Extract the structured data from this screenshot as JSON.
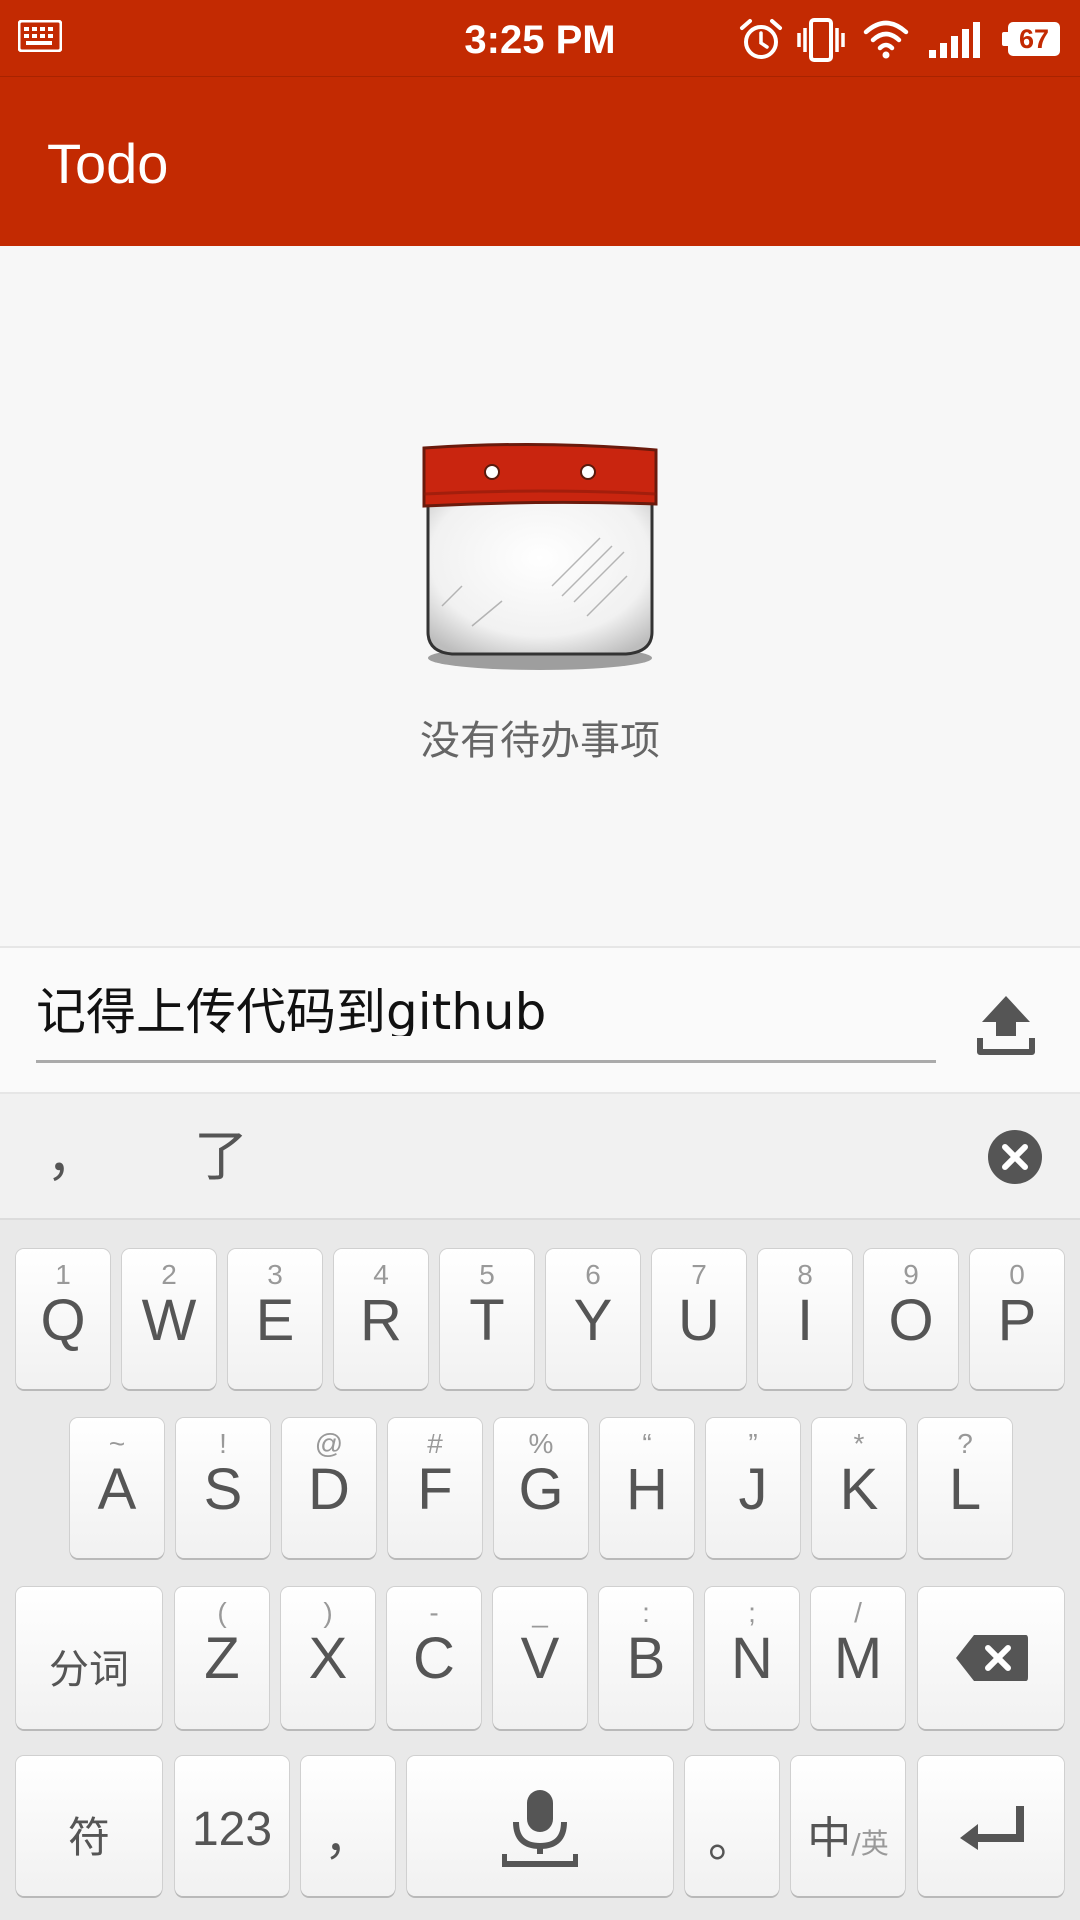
{
  "status_bar": {
    "time": "3:25 PM",
    "battery_level": "67",
    "icons": [
      "keyboard-icon",
      "alarm-icon",
      "vibrate-icon",
      "wifi-icon",
      "signal-icon",
      "battery-icon"
    ]
  },
  "app_bar": {
    "title": "Todo"
  },
  "empty_state": {
    "icon": "calendar-icon",
    "text": "没有待办事项"
  },
  "input": {
    "value": "记得上传代码到github",
    "submit_icon": "upload-icon"
  },
  "candidates": {
    "items": [
      "，",
      "了"
    ],
    "close_icon": "close-icon"
  },
  "keyboard": {
    "row1": [
      {
        "main": "Q",
        "sub": "1"
      },
      {
        "main": "W",
        "sub": "2"
      },
      {
        "main": "E",
        "sub": "3"
      },
      {
        "main": "R",
        "sub": "4"
      },
      {
        "main": "T",
        "sub": "5"
      },
      {
        "main": "Y",
        "sub": "6"
      },
      {
        "main": "U",
        "sub": "7"
      },
      {
        "main": "I",
        "sub": "8"
      },
      {
        "main": "O",
        "sub": "9"
      },
      {
        "main": "P",
        "sub": "0"
      }
    ],
    "row2": [
      {
        "main": "A",
        "sub": "~"
      },
      {
        "main": "S",
        "sub": "!"
      },
      {
        "main": "D",
        "sub": "@"
      },
      {
        "main": "F",
        "sub": "#"
      },
      {
        "main": "G",
        "sub": "%"
      },
      {
        "main": "H",
        "sub": "“"
      },
      {
        "main": "J",
        "sub": "”"
      },
      {
        "main": "K",
        "sub": "*"
      },
      {
        "main": "L",
        "sub": "?"
      }
    ],
    "row3": [
      {
        "main": "Z",
        "sub": "("
      },
      {
        "main": "X",
        "sub": ")"
      },
      {
        "main": "C",
        "sub": "-"
      },
      {
        "main": "V",
        "sub": "_"
      },
      {
        "main": "B",
        "sub": ":"
      },
      {
        "main": "N",
        "sub": ";"
      },
      {
        "main": "M",
        "sub": "/"
      }
    ],
    "segment_label": "分词",
    "symbols_label": "符",
    "numbers_label": "123",
    "comma_label": "，",
    "period_label": "。",
    "lang_main": "中",
    "lang_sub": "/英",
    "backspace_icon": "backspace-icon",
    "mic_icon": "microphone-icon",
    "enter_icon": "enter-icon"
  }
}
